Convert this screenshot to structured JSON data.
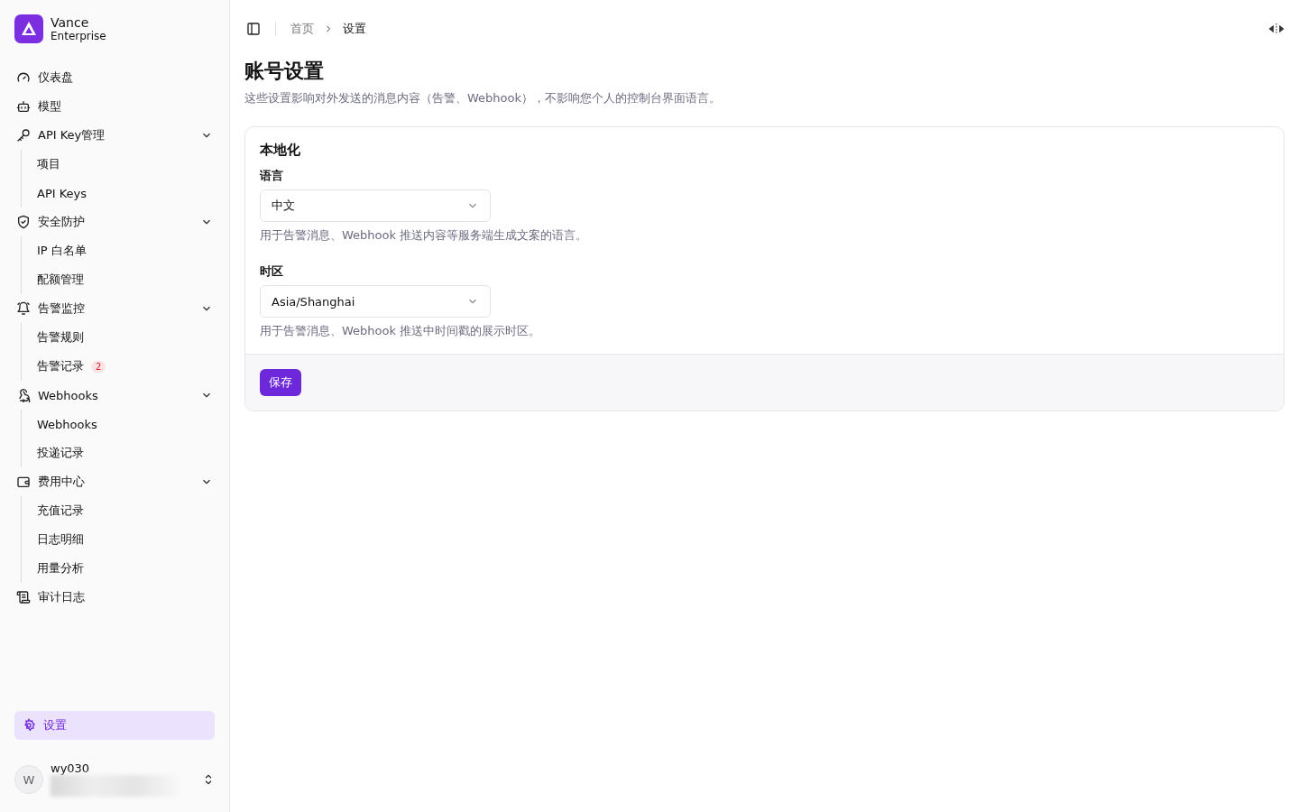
{
  "brand": {
    "name": "Vance",
    "subtitle": "Enterprise"
  },
  "nav": [
    {
      "label": "仪表盘"
    },
    {
      "label": "模型"
    },
    {
      "label": "API Key管理",
      "expanded": true,
      "children": [
        {
          "label": "项目"
        },
        {
          "label": "API Keys"
        }
      ]
    },
    {
      "label": "安全防护",
      "expanded": true,
      "children": [
        {
          "label": "IP 白名单"
        },
        {
          "label": "配额管理"
        }
      ]
    },
    {
      "label": "告警监控",
      "expanded": true,
      "children": [
        {
          "label": "告警规则"
        },
        {
          "label": "告警记录",
          "badge": "2"
        }
      ]
    },
    {
      "label": "Webhooks",
      "expanded": true,
      "children": [
        {
          "label": "Webhooks"
        },
        {
          "label": "投递记录"
        }
      ]
    },
    {
      "label": "费用中心",
      "expanded": true,
      "children": [
        {
          "label": "充值记录"
        },
        {
          "label": "日志明细"
        },
        {
          "label": "用量分析"
        }
      ]
    },
    {
      "label": "审计日志"
    }
  ],
  "settings_item": {
    "label": "设置",
    "selected": true
  },
  "user": {
    "initial": "W",
    "name": "wy030"
  },
  "breadcrumb": [
    {
      "label": "首页"
    },
    {
      "label": "设置"
    }
  ],
  "page": {
    "title": "账号设置",
    "description": "这些设置影响对外发送的消息内容（告警、Webhook），不影响您个人的控制台界面语言。"
  },
  "card": {
    "title": "本地化",
    "fields": [
      {
        "label": "语言",
        "value": "中文",
        "help": "用于告警消息、Webhook 推送内容等服务端生成文案的语言。"
      },
      {
        "label": "时区",
        "value": "Asia/Shanghai",
        "help": "用于告警消息、Webhook 推送中时间戳的展示时区。"
      }
    ],
    "save_label": "保存"
  }
}
